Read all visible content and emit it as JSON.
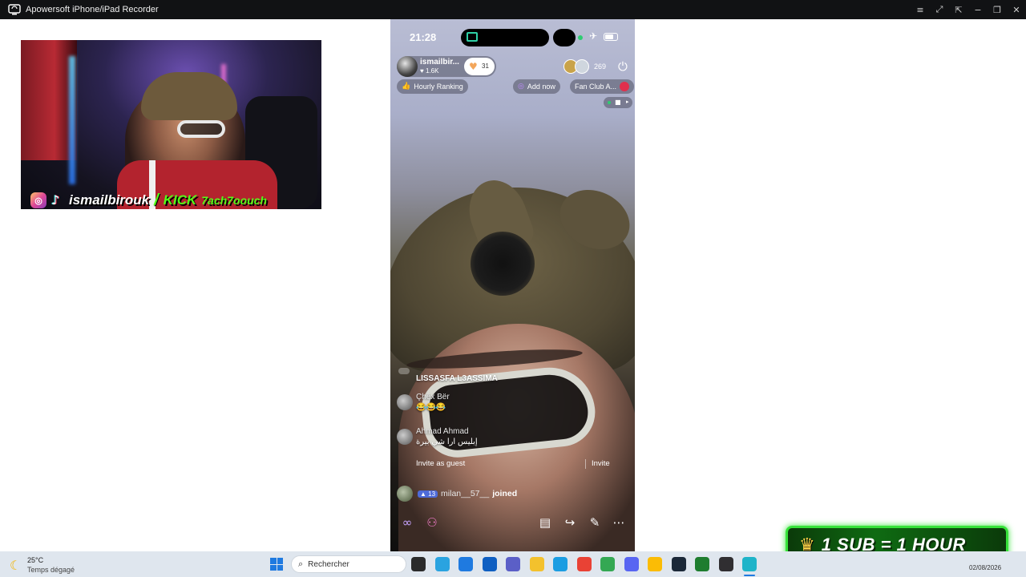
{
  "window": {
    "title": "Apowersoft iPhone/iPad Recorder",
    "controls": [
      "≡",
      "⤢",
      "⇱",
      "−",
      "❐",
      "✕"
    ]
  },
  "webcam": {
    "handle": "ismailbirouk",
    "kick_label": "KICK",
    "kick_name": "7ach7oouch"
  },
  "phone": {
    "status": {
      "time": "21:28"
    },
    "host": {
      "name": "ismailbir...",
      "likes": "1.6K",
      "follow_count": "31"
    },
    "viewer_count": "269",
    "hourly_ranking": "Hourly Ranking",
    "add_now": "Add now",
    "fan_club": "Fan Club A...",
    "chat": {
      "title": "LISSASFA L3ASSIMA",
      "messages": [
        {
          "name": "Çhêx Bër",
          "text": "😂😂😂"
        },
        {
          "name": "Ahmad Ahmad",
          "text": "إبليس ارا شي بيرة"
        }
      ]
    },
    "invite_as_guest": "Invite as guest",
    "invite": "Invite",
    "joined": {
      "level": "13",
      "user": "milan__57__",
      "text": "joined"
    }
  },
  "promo": {
    "text": "1 SUB = 1 HOUR"
  },
  "taskbar": {
    "temperature": "25°C",
    "weather_desc": "Temps dégagé",
    "search_placeholder": "Rechercher",
    "date": "02/08/2026",
    "apps": [
      {
        "name": "file-explorer-dark",
        "color": "#2b2b2b"
      },
      {
        "name": "telegram",
        "color": "#2aa3e0"
      },
      {
        "name": "store",
        "color": "#1f7ae0"
      },
      {
        "name": "outlook",
        "color": "#0f5fc2"
      },
      {
        "name": "teams",
        "color": "#5b5fc7"
      },
      {
        "name": "folder",
        "color": "#f3c12d"
      },
      {
        "name": "edge",
        "color": "#1b9de2"
      },
      {
        "name": "chrome",
        "color": "#e94235"
      },
      {
        "name": "chrome-2",
        "color": "#34a853"
      },
      {
        "name": "discord",
        "color": "#5865f2"
      },
      {
        "name": "chrome-3",
        "color": "#fbbc05"
      },
      {
        "name": "steam",
        "color": "#1b2838"
      },
      {
        "name": "terminal",
        "color": "#1e7d2f"
      },
      {
        "name": "obs",
        "color": "#302e31"
      },
      {
        "name": "recorder",
        "color": "#1fb4c9"
      }
    ]
  }
}
